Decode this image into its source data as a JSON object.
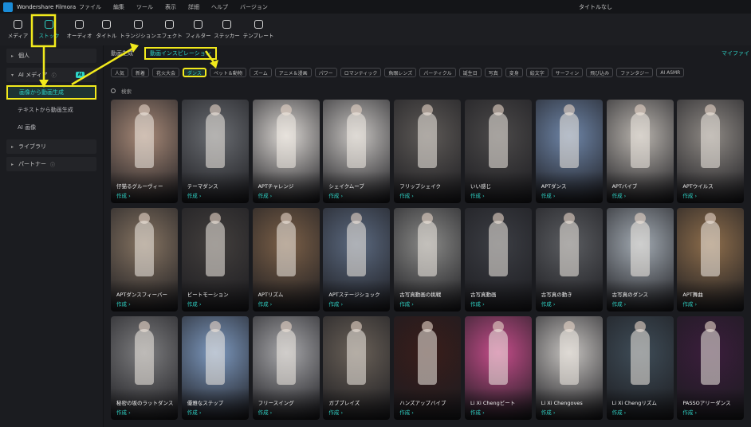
{
  "app": {
    "brand": "Wondershare Filmora",
    "window_title": "タイトルなし"
  },
  "menu": [
    "ファイル",
    "編集",
    "ツール",
    "表示",
    "詳細",
    "ヘルプ",
    "バージョン"
  ],
  "toolbar": [
    {
      "label": "メディア",
      "icon": "media-icon"
    },
    {
      "label": "ストック",
      "icon": "stock-icon",
      "active": true
    },
    {
      "label": "オーディオ",
      "icon": "audio-icon"
    },
    {
      "label": "タイトル",
      "icon": "title-icon"
    },
    {
      "label": "トランジション",
      "icon": "transition-icon"
    },
    {
      "label": "エフェクト",
      "icon": "effect-icon"
    },
    {
      "label": "フィルター",
      "icon": "filter-icon"
    },
    {
      "label": "ステッカー",
      "icon": "sticker-icon"
    },
    {
      "label": "テンプレート",
      "icon": "template-icon"
    }
  ],
  "sidebar": {
    "personal": "個人",
    "ai_media": "AI メディア",
    "ai_badge": "AI",
    "sub_items": [
      "画像から動画生成",
      "テキストから動画生成",
      "AI 画像"
    ],
    "library": "ライブラリ",
    "partner": "パートナー"
  },
  "content": {
    "tabs": [
      "動画生成",
      "動画インスピレーション"
    ],
    "right_label": "マイファイ",
    "chips": [
      "人気",
      "新着",
      "花火大会",
      "ダンス",
      "ペット＆動物",
      "ズーム",
      "アニメ＆漫画",
      "パワー",
      "ロマンティック",
      "魚眼レンズ",
      "パーティクル",
      "誕生日",
      "写真",
      "変身",
      "絵文字",
      "サーフィン",
      "飛び込み",
      "ファンタジー",
      "AI ASMR"
    ],
    "active_chip": "ダンス",
    "search_placeholder": "検索",
    "make_label": "作成 ›",
    "cards": [
      [
        "仔猫るグルーヴィー",
        "テーマダンス",
        "APTチャレンジ",
        "シェイクムーブ",
        "フリップシェイク",
        "いい感じ",
        "APTダンス",
        "APTバイブ",
        "APTウイルス"
      ],
      [
        "APTダンスフィーバー",
        "ビートモーション",
        "APTリズム",
        "APTステージショック",
        "古写真動画の挑戦",
        "古写真動画",
        "古写真の動き",
        "古写真のダンス",
        "APT舞曲"
      ],
      [
        "秘密の坂のラットダンス",
        "優雅なステップ",
        "フリースイング",
        "ガブブレイズ",
        "ハンズアップバイブ",
        "Li Xi Chengビート",
        "Li Xi Chengoves",
        "Li Xi Chengリズム",
        "PASSOアリーダンス"
      ]
    ],
    "card_colors": [
      [
        "#a88a78",
        "#6a6d72",
        "#dad6d2",
        "#c7c4c1",
        "#5e5a57",
        "#4c4a4a",
        "#6f86a8",
        "#b9b4ae",
        "#8f8a85"
      ],
      [
        "#867462",
        "#433f3d",
        "#7b6048",
        "#5c6a80",
        "#8a8a88",
        "#3c3e44",
        "#5b5d61",
        "#a3abb3",
        "#8e6e4c"
      ],
      [
        "#7e7e80",
        "#7e9ac0",
        "#a7a7aa",
        "#6a6158",
        "#3a1d1a",
        "#c54d8a",
        "#c6c3c0",
        "#3f4d58",
        "#3b1d3c"
      ]
    ]
  }
}
